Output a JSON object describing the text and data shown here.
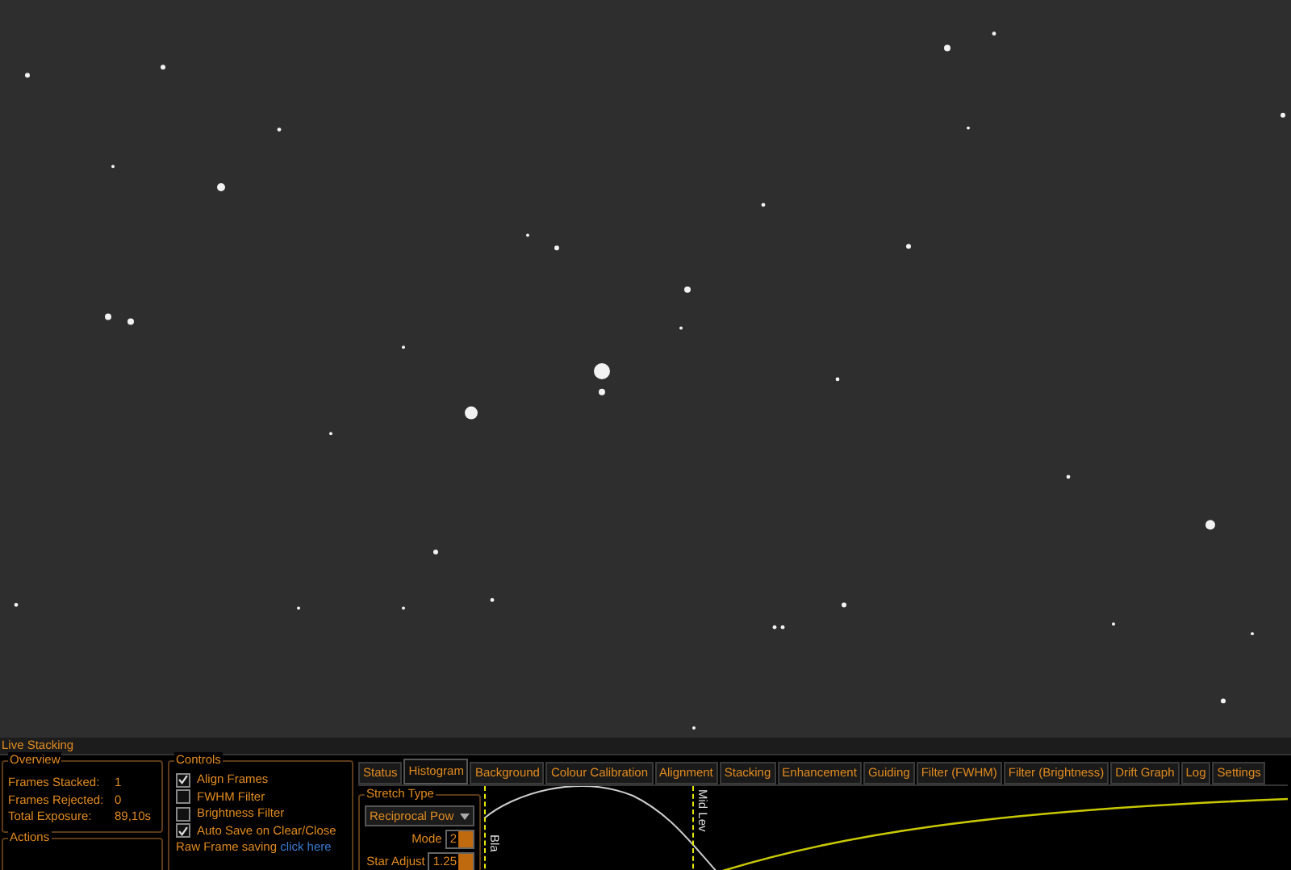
{
  "panel": {
    "title": "Live Stacking"
  },
  "overview": {
    "title": "Overview",
    "rows": [
      {
        "label": "Frames Stacked:",
        "value": "1"
      },
      {
        "label": "Frames Rejected:",
        "value": "0"
      },
      {
        "label": "Total Exposure:",
        "value": "89,10s"
      }
    ]
  },
  "actions": {
    "title": "Actions"
  },
  "controls": {
    "title": "Controls",
    "items": [
      {
        "label": "Align Frames",
        "checked": true
      },
      {
        "label": "FWHM Filter",
        "checked": false
      },
      {
        "label": "Brightness Filter",
        "checked": false
      },
      {
        "label": "Auto Save on Clear/Close",
        "checked": true
      }
    ],
    "raw_frame": {
      "text": "Raw Frame saving",
      "link": "click here"
    }
  },
  "tabs": [
    {
      "label": "Status",
      "selected": false
    },
    {
      "label": "Histogram",
      "selected": true
    },
    {
      "label": "Background",
      "selected": false
    },
    {
      "label": "Colour Calibration",
      "selected": false
    },
    {
      "label": "Alignment",
      "selected": false
    },
    {
      "label": "Stacking",
      "selected": false
    },
    {
      "label": "Enhancement",
      "selected": false
    },
    {
      "label": "Guiding",
      "selected": false
    },
    {
      "label": "Filter (FWHM)",
      "selected": false
    },
    {
      "label": "Filter (Brightness)",
      "selected": false
    },
    {
      "label": "Drift Graph",
      "selected": false
    },
    {
      "label": "Log",
      "selected": false
    },
    {
      "label": "Settings",
      "selected": false
    }
  ],
  "stretch": {
    "title": "Stretch Type",
    "dropdown": "Reciprocal Pow",
    "mode_label": "Mode",
    "mode_value": "2",
    "star_label": "Star Adjust",
    "star_value": "1.25"
  },
  "histogram": {
    "black_label": "Bla",
    "mid_label": "Mid Lev"
  }
}
